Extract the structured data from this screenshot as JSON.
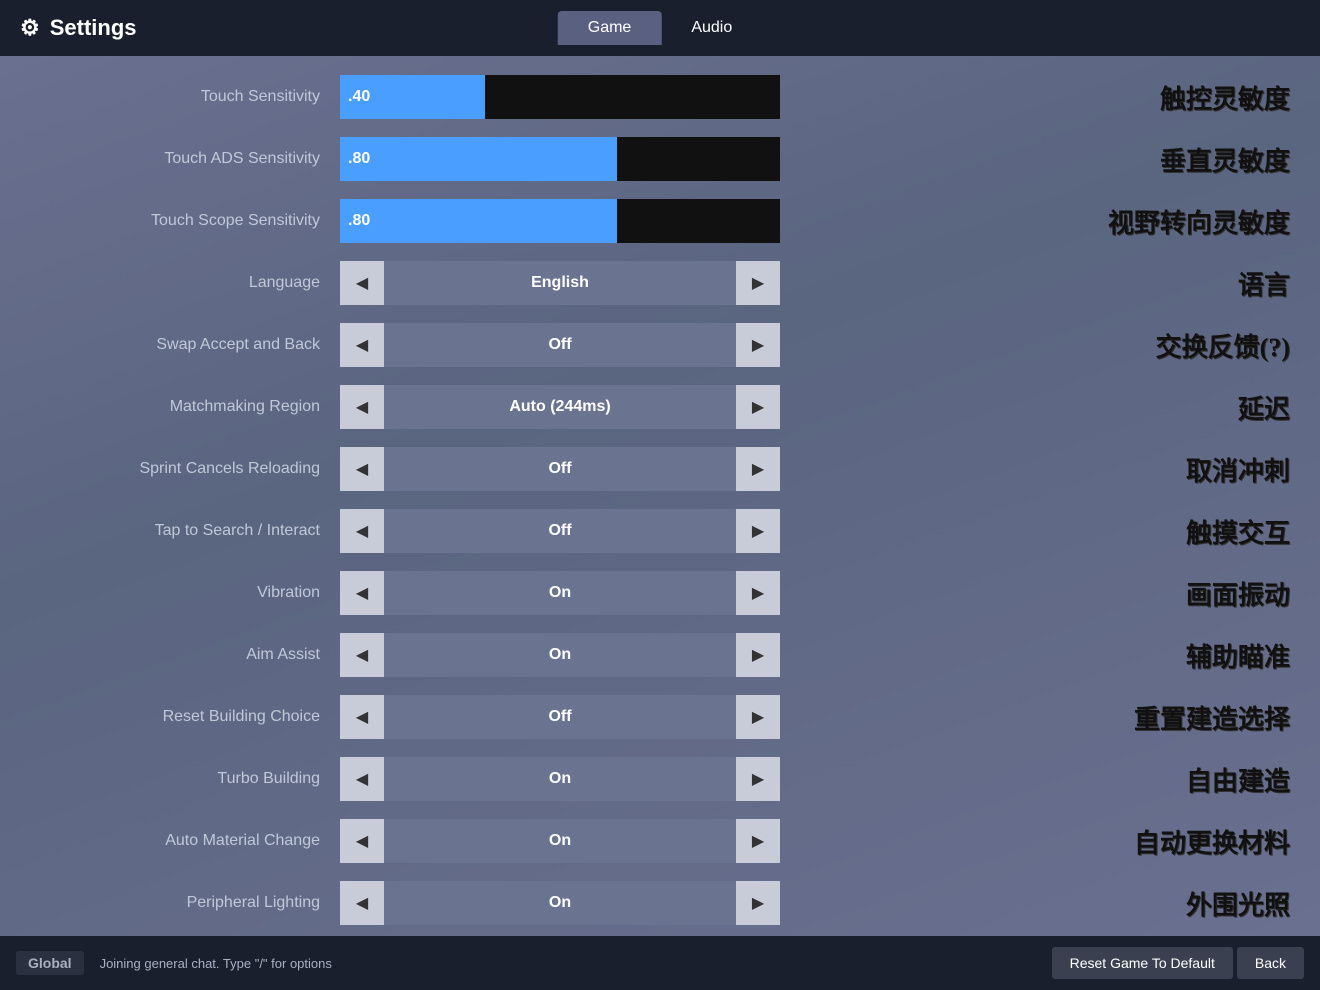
{
  "header": {
    "title": "Settings",
    "gear": "⚙",
    "tabs": [
      {
        "label": "Game",
        "active": true
      },
      {
        "label": "Audio",
        "active": false
      }
    ]
  },
  "settings": {
    "sliders": [
      {
        "label": "Touch Sensitivity",
        "value": ".40",
        "fill_pct": 33,
        "chinese": "触控灵敏度"
      },
      {
        "label": "Touch ADS Sensitivity",
        "value": ".80",
        "fill_pct": 63,
        "chinese": "垂直灵敏度"
      },
      {
        "label": "Touch Scope Sensitivity",
        "value": ".80",
        "fill_pct": 63,
        "chinese": "视野转向灵敏度"
      }
    ],
    "selectors": [
      {
        "label": "Language",
        "value": "English",
        "chinese": "语言"
      },
      {
        "label": "Swap Accept and Back",
        "value": "Off",
        "chinese": "交换反馈(?)"
      },
      {
        "label": "Matchmaking Region",
        "value": "Auto (244ms)",
        "chinese": "延迟"
      },
      {
        "label": "Sprint Cancels Reloading",
        "value": "Off",
        "chinese": "取消冲刺"
      },
      {
        "label": "Tap to Search / Interact",
        "value": "Off",
        "chinese": "触摸交互"
      },
      {
        "label": "Vibration",
        "value": "On",
        "chinese": "画面振动"
      },
      {
        "label": "Aim Assist",
        "value": "On",
        "chinese": "辅助瞄准"
      },
      {
        "label": "Reset Building Choice",
        "value": "Off",
        "chinese": "重置建造选择"
      },
      {
        "label": "Turbo Building",
        "value": "On",
        "chinese": "自由建造"
      },
      {
        "label": "Auto Material Change",
        "value": "On",
        "chinese": "自动更换材料"
      },
      {
        "label": "Peripheral Lighting",
        "value": "On",
        "chinese": "外围光照"
      }
    ]
  },
  "footer": {
    "global_label": "Global",
    "chat_text": "Joining general chat. Type \"/\" for options",
    "reset_label": "Reset Game To Default",
    "back_label": "Back"
  }
}
